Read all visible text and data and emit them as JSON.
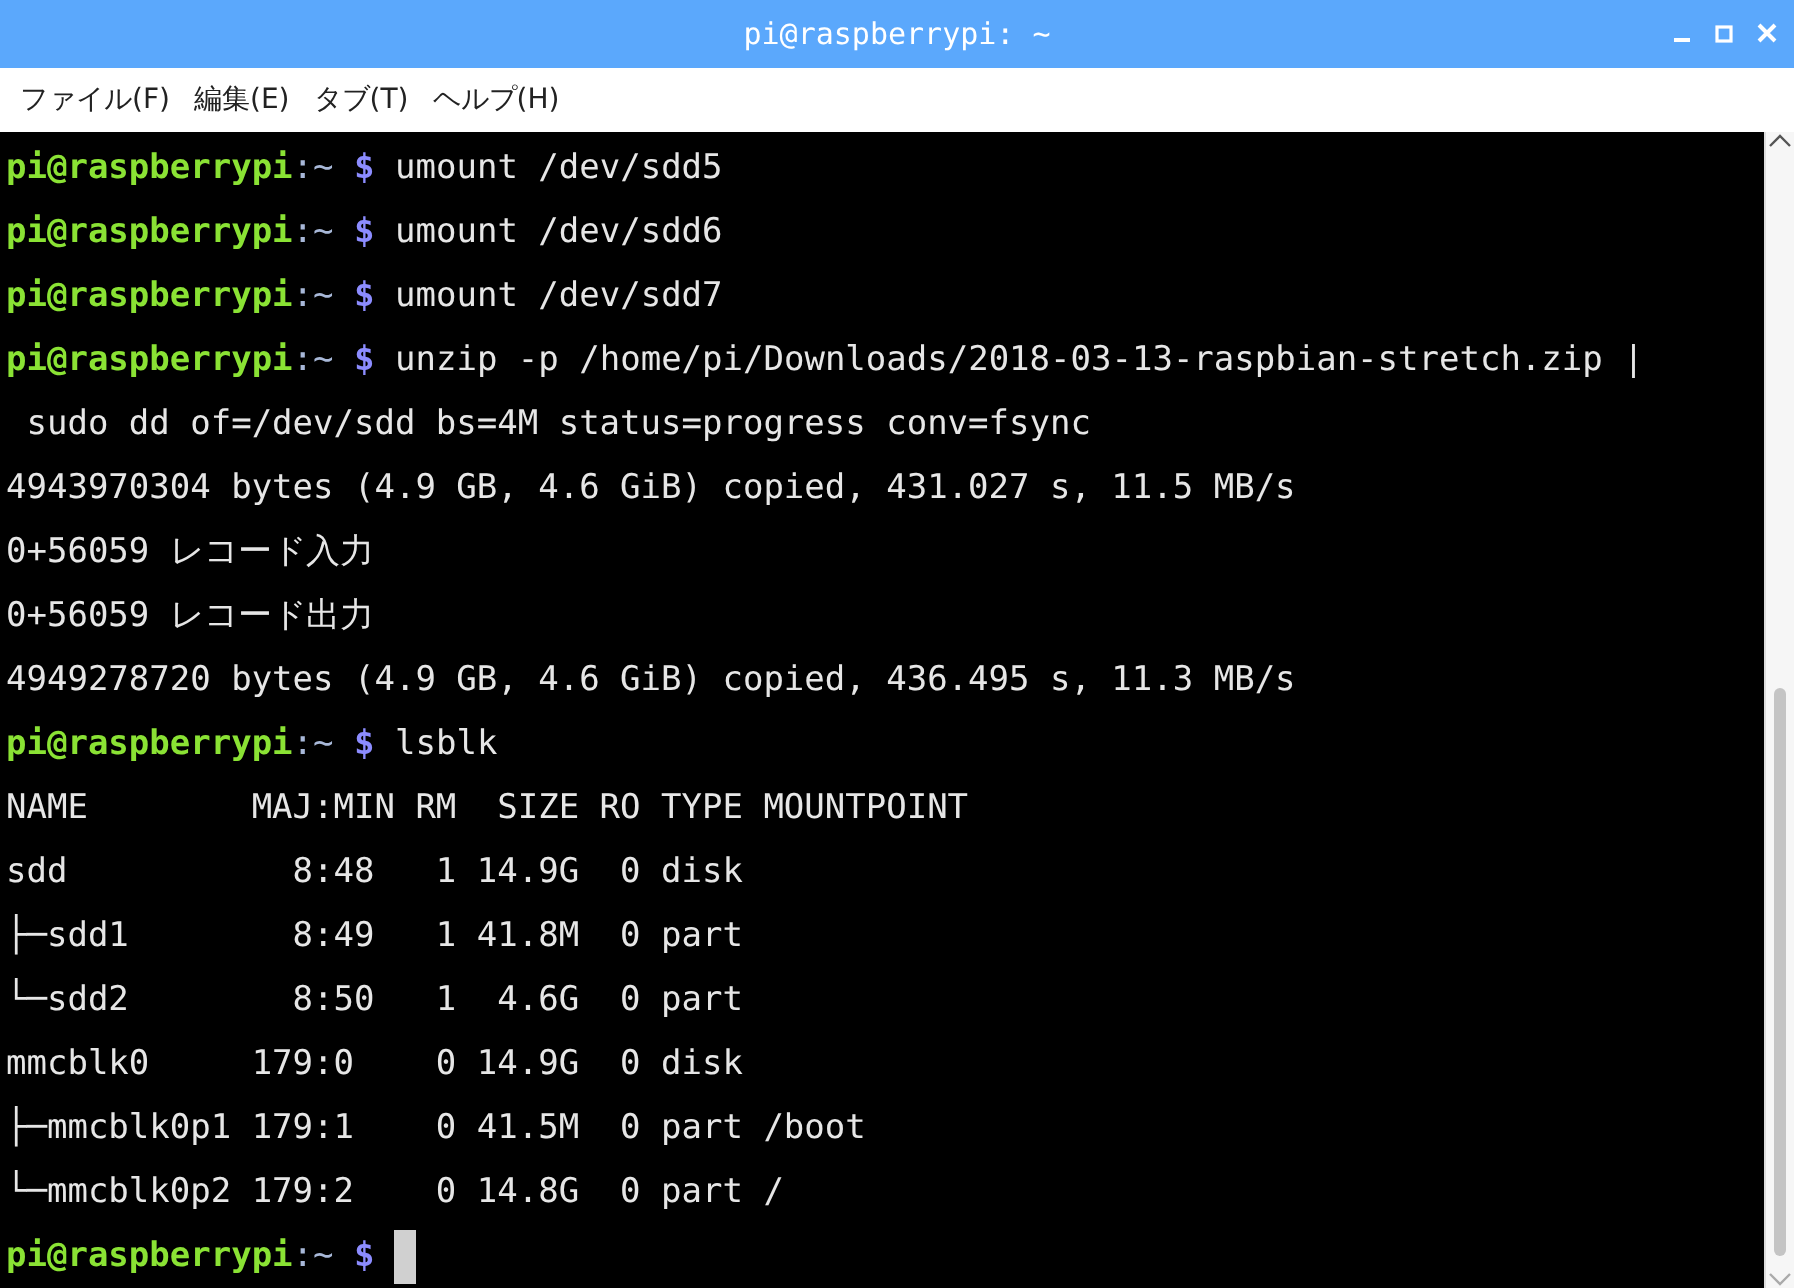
{
  "window": {
    "title": "pi@raspberrypi: ~"
  },
  "menu": [
    "ファイル(F)",
    "編集(E)",
    "タブ(T)",
    "ヘルプ(H)"
  ],
  "terminal": {
    "lines": [
      {
        "kind": "prompt",
        "user_host": "pi@raspberrypi",
        "path": ":~",
        "symbol": "$",
        "command": "umount /dev/sdd5"
      },
      {
        "kind": "prompt",
        "user_host": "pi@raspberrypi",
        "path": ":~",
        "symbol": "$",
        "command": "umount /dev/sdd6"
      },
      {
        "kind": "prompt",
        "user_host": "pi@raspberrypi",
        "path": ":~",
        "symbol": "$",
        "command": "umount /dev/sdd7"
      },
      {
        "kind": "prompt",
        "user_host": "pi@raspberrypi",
        "path": ":~",
        "symbol": "$",
        "command": "unzip -p /home/pi/Downloads/2018-03-13-raspbian-stretch.zip |"
      },
      {
        "kind": "output",
        "text": " sudo dd of=/dev/sdd bs=4M status=progress conv=fsync"
      },
      {
        "kind": "output",
        "text": "4943970304 bytes (4.9 GB, 4.6 GiB) copied, 431.027 s, 11.5 MB/s"
      },
      {
        "kind": "output",
        "text": "0+56059 レコード入力"
      },
      {
        "kind": "output",
        "text": "0+56059 レコード出力"
      },
      {
        "kind": "output",
        "text": "4949278720 bytes (4.9 GB, 4.6 GiB) copied, 436.495 s, 11.3 MB/s"
      },
      {
        "kind": "prompt",
        "user_host": "pi@raspberrypi",
        "path": ":~",
        "symbol": "$",
        "command": "lsblk"
      },
      {
        "kind": "output",
        "text": "NAME        MAJ:MIN RM  SIZE RO TYPE MOUNTPOINT"
      },
      {
        "kind": "output",
        "text": "sdd           8:48   1 14.9G  0 disk"
      },
      {
        "kind": "output",
        "text": "├─sdd1        8:49   1 41.8M  0 part"
      },
      {
        "kind": "output",
        "text": "└─sdd2        8:50   1  4.6G  0 part"
      },
      {
        "kind": "output",
        "text": "mmcblk0     179:0    0 14.9G  0 disk"
      },
      {
        "kind": "output",
        "text": "├─mmcblk0p1 179:1    0 41.5M  0 part /boot"
      },
      {
        "kind": "output",
        "text": "└─mmcblk0p2 179:2    0 14.8G  0 part /"
      },
      {
        "kind": "prompt",
        "user_host": "pi@raspberrypi",
        "path": ":~",
        "symbol": "$"
      }
    ]
  }
}
